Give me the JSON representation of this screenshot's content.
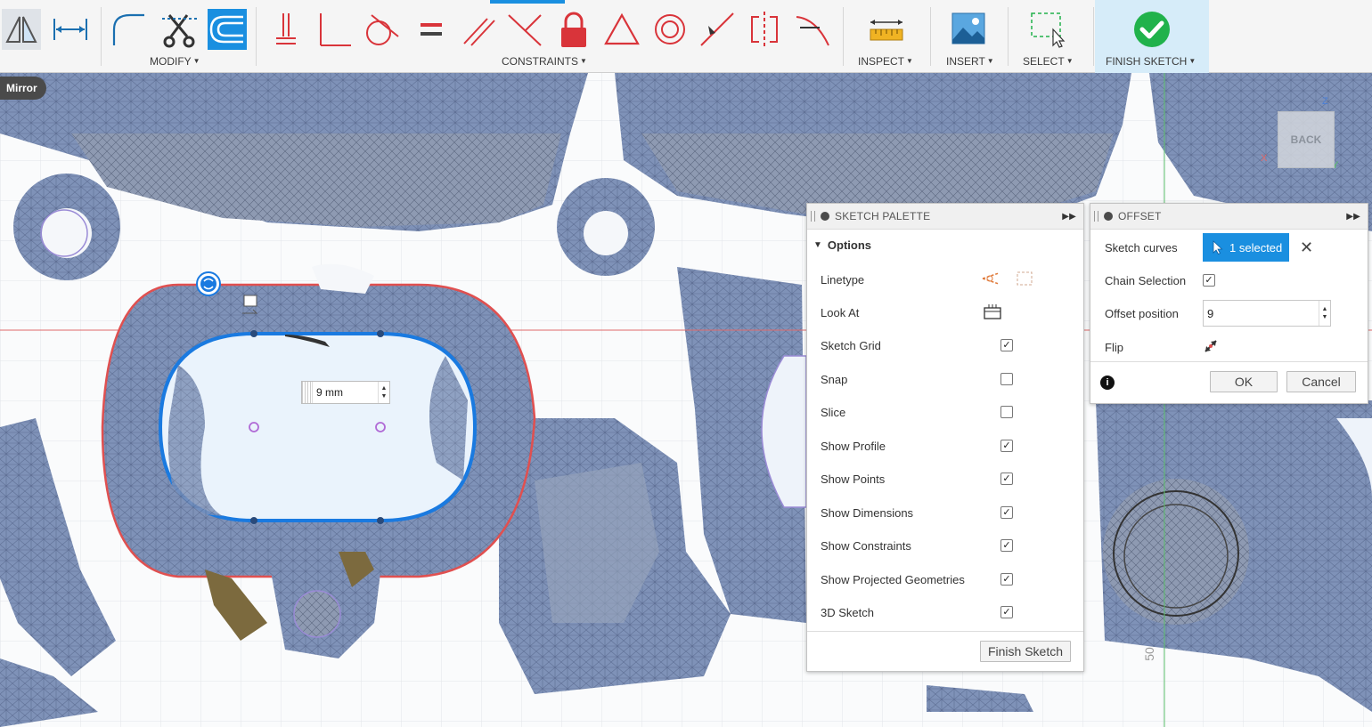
{
  "toolbar": {
    "groups": {
      "modify": "MODIFY",
      "constraints": "CONSTRAINTS",
      "inspect": "INSPECT",
      "insert": "INSERT",
      "select": "SELECT",
      "finish_sketch": "FINISH SKETCH"
    }
  },
  "command_badge": "Mirror",
  "viewcube_label": "BACK",
  "viewport": {
    "dimension_input_value": "9 mm",
    "axis_label": "50"
  },
  "sketch_palette": {
    "title": "SKETCH PALETTE",
    "section": "Options",
    "rows": [
      {
        "label": "Linetype",
        "control": "icons"
      },
      {
        "label": "Look At",
        "control": "icon"
      },
      {
        "label": "Sketch Grid",
        "checked": true
      },
      {
        "label": "Snap",
        "checked": false
      },
      {
        "label": "Slice",
        "checked": false
      },
      {
        "label": "Show Profile",
        "checked": true
      },
      {
        "label": "Show Points",
        "checked": true
      },
      {
        "label": "Show Dimensions",
        "checked": true
      },
      {
        "label": "Show Constraints",
        "checked": true
      },
      {
        "label": "Show Projected Geometries",
        "checked": true
      },
      {
        "label": "3D Sketch",
        "checked": true
      }
    ],
    "finish_button": "Finish Sketch"
  },
  "offset_panel": {
    "title": "OFFSET",
    "sketch_curves_label": "Sketch curves",
    "selection_text": "1 selected",
    "chain_selection_label": "Chain Selection",
    "chain_selection_checked": true,
    "offset_position_label": "Offset position",
    "offset_position_value": "9",
    "flip_label": "Flip",
    "ok_label": "OK",
    "cancel_label": "Cancel"
  },
  "colors": {
    "accent_blue": "#1a8fe0",
    "finish_green": "#21b24b",
    "constraint_red": "#d9343a",
    "mesh_blue": "#7f92b8"
  }
}
